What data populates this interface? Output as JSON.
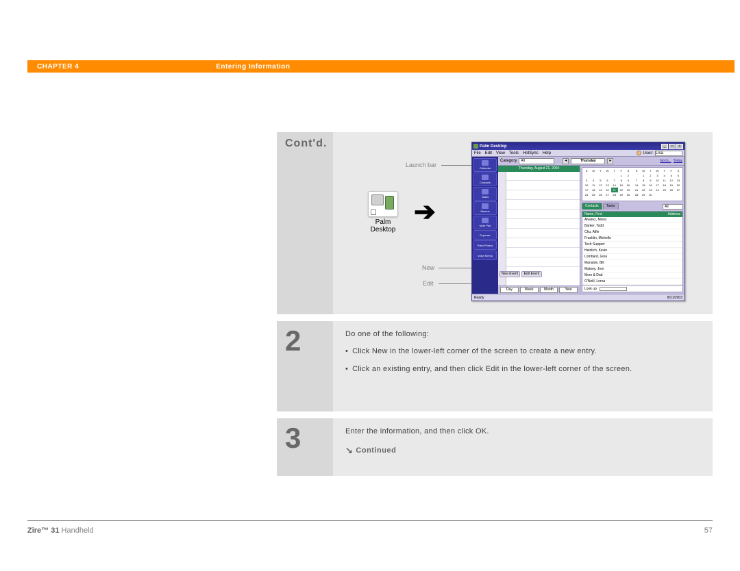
{
  "header": {
    "chapter": "CHAPTER 4",
    "title": "Entering Information"
  },
  "step1": {
    "label": "Cont'd."
  },
  "callouts": {
    "launch_bar": "Launch bar",
    "new": "New",
    "edit": "Edit"
  },
  "palm_icon": {
    "label": "Palm Desktop"
  },
  "app": {
    "title": "Palm Desktop",
    "menus": [
      "File",
      "Edit",
      "View",
      "Tools",
      "HotSync",
      "Help"
    ],
    "user_label": "User:",
    "user_value": "Lisa",
    "category_label": "Category",
    "category_value": "All",
    "day_nav": "Thursday",
    "nav_links": [
      "Go to...",
      "Today"
    ],
    "day_header": "Thursday, August 21, 2004",
    "launch_items": [
      "Calendar",
      "Contacts",
      "Tasks",
      "Memos",
      "Note Pad",
      "Expense",
      "Palm Photos",
      "Voice Memo"
    ],
    "contact_tabs": [
      "Contacts",
      "Tasks"
    ],
    "contact_tab_all": "All",
    "contact_header": "Name, First",
    "contact_col2": "Address",
    "contacts": [
      "Alvarez, Mona",
      "Barker, Todd",
      "Chu, Alfie",
      "Franklin, Michelle",
      "Tech Support",
      "Heinlich, Kevin",
      "Lombard, Gina",
      "Manaole, Bill",
      "Matney, Jorn",
      "Mom & Dad",
      "O'Neill, Lorna"
    ],
    "lookup_label": "Look up:",
    "action_buttons": [
      "New Event",
      "Edit Event"
    ],
    "view_tabs": [
      "Day",
      "Week",
      "Month",
      "Year"
    ],
    "status": "Ready",
    "date_stamp": "8/21/2003"
  },
  "step2": {
    "num": "2",
    "lead": "Do one of the following:",
    "bullets": [
      "Click New in the lower-left corner of the screen to create a new entry.",
      "Click an existing entry, and then click Edit in the lower-left corner of the screen."
    ]
  },
  "step3": {
    "num": "3",
    "lead": "Enter the information, and then click OK.",
    "continued": "Continued"
  },
  "footer": {
    "product_bold": "Zire™ 31",
    "product_rest": " Handheld",
    "page": "57"
  }
}
